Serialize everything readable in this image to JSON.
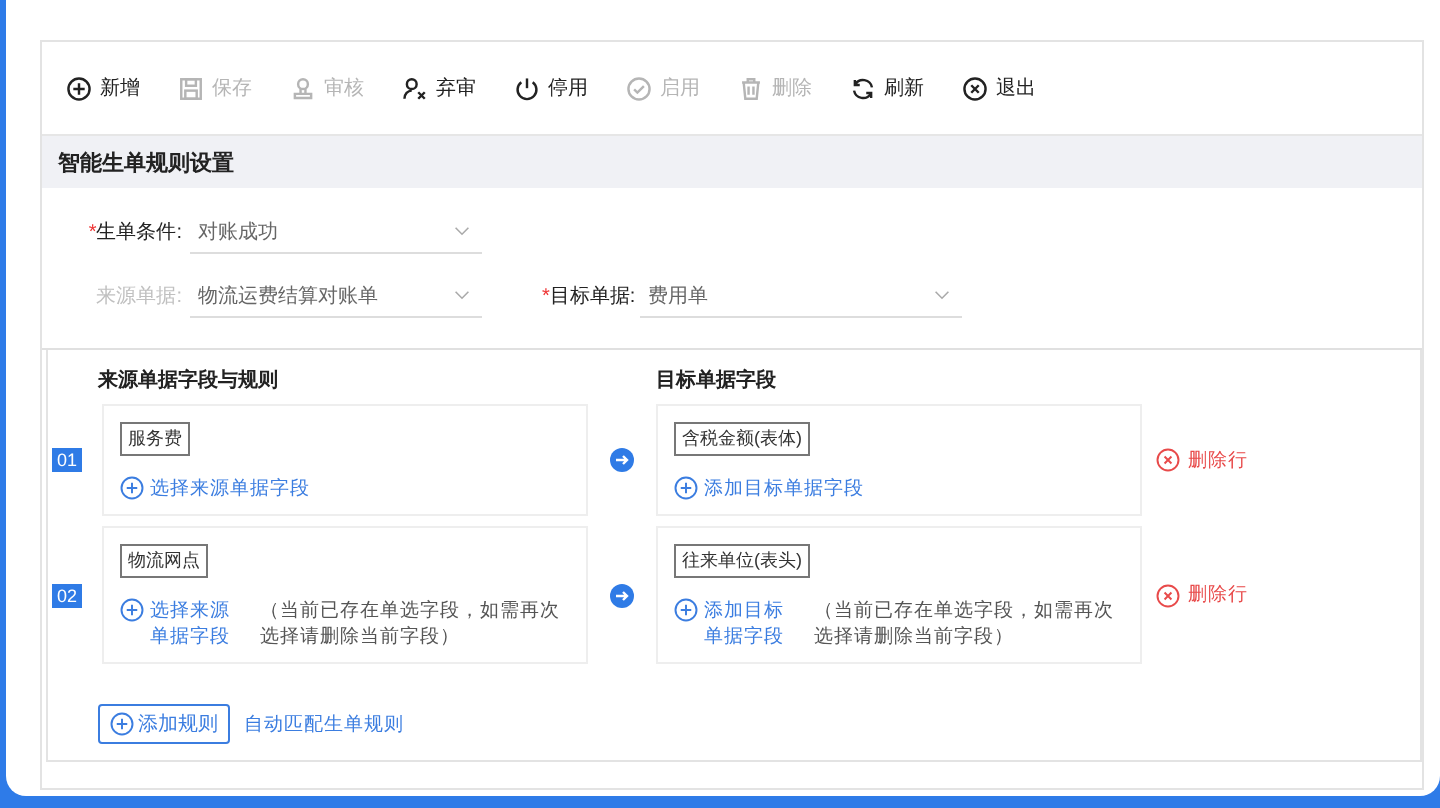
{
  "toolbar": [
    {
      "label": "新增",
      "disabled": false
    },
    {
      "label": "保存",
      "disabled": true
    },
    {
      "label": "审核",
      "disabled": true
    },
    {
      "label": "弃审",
      "disabled": false
    },
    {
      "label": "停用",
      "disabled": false
    },
    {
      "label": "启用",
      "disabled": true
    },
    {
      "label": "删除",
      "disabled": true
    },
    {
      "label": "刷新",
      "disabled": false
    },
    {
      "label": "退出",
      "disabled": false
    }
  ],
  "section_title": "智能生单规则设置",
  "form_rows": [
    [
      {
        "label": "生单条件:",
        "value": "对账成功",
        "required_mark": "*",
        "disabled": false
      }
    ],
    [
      {
        "label": "来源单据:",
        "value": "物流运费结算对账单",
        "disabled": true
      },
      {
        "label": "目标单据:",
        "value": "费用单",
        "required_mark": "*",
        "disabled": false
      }
    ]
  ],
  "rules": {
    "source_heading": "来源单据字段与规则",
    "target_heading": "目标单据字段",
    "rows": [
      {
        "number": "01",
        "source": {
          "tag": "服务费",
          "link": "选择来源单据字段"
        },
        "target": {
          "tag": "含税金额(表体)",
          "link": "添加目标单据字段"
        },
        "delete": "删除行"
      },
      {
        "number": "02",
        "source": {
          "tag": "物流网点",
          "link": "选择来源单据字段",
          "note": "（当前已存在单选字段，如需再次选择请删除当前字段）"
        },
        "target": {
          "tag": "往来单位(表头)",
          "link": "添加目标单据字段",
          "note": "（当前已存在单选字段，如需再次选择请删除当前字段）"
        },
        "delete": "删除行"
      }
    ],
    "add_button": "添加规则",
    "auto_link": "自动匹配生单规则"
  }
}
